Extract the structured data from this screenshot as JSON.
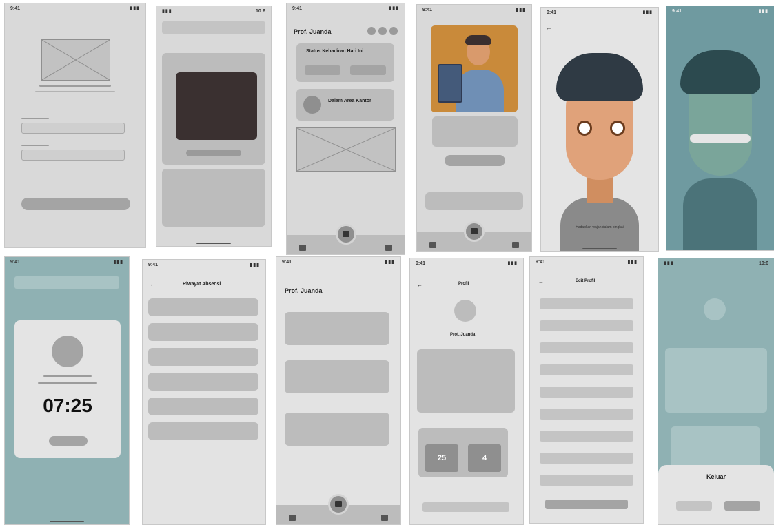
{
  "status_time": "9:41",
  "status_alt_time": "10:6",
  "colors": {
    "accent": "#e8a03a",
    "skin": "#d99a6c",
    "hair": "#3a2f2f",
    "teal_overlay": "#4f8a8f"
  },
  "dashboard": {
    "user_name": "Prof. Juanda",
    "status_title": "Status Kehadiran Hari Ini",
    "area_title": "Dalam Area Kantor"
  },
  "face_scan": {
    "instruction": "Hadapkan wajah dalam bingkai"
  },
  "attendance_modal": {
    "time": "07:25"
  },
  "history": {
    "title": "Riwayat Absensi"
  },
  "activity": {
    "user_name": "Prof. Juanda"
  },
  "profile": {
    "title": "Profil",
    "name": "Prof. Juanda",
    "stat_present": "25",
    "stat_late": "4"
  },
  "edit_profile": {
    "title": "Edit Profil"
  },
  "logout": {
    "title": "Keluar"
  }
}
